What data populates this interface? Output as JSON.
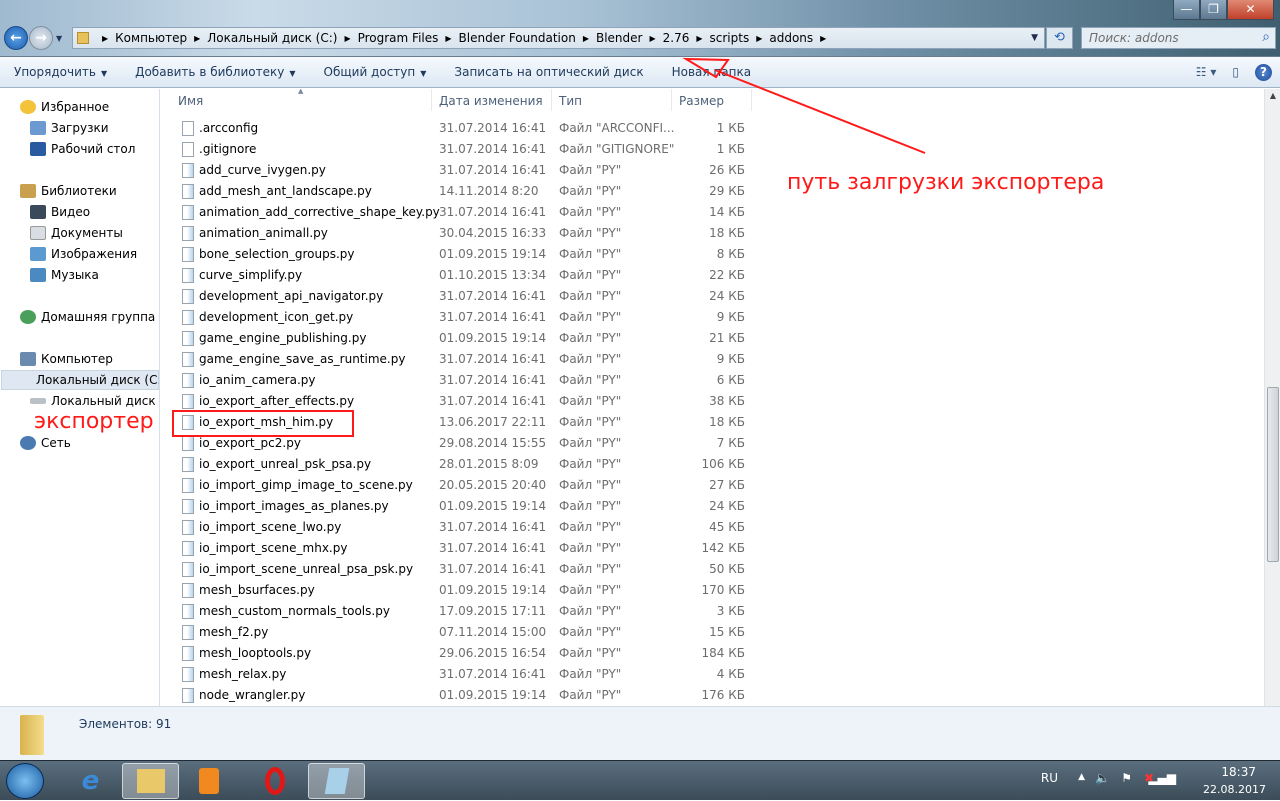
{
  "window": {
    "minimize": "minimize",
    "maximize": "restore",
    "close": "close"
  },
  "address": {
    "crumbs": [
      "Компьютер",
      "Локальный диск (C:)",
      "Program Files",
      "Blender Foundation",
      "Blender",
      "2.76",
      "scripts",
      "addons"
    ]
  },
  "search": {
    "placeholder": "Поиск: addons"
  },
  "toolbar": {
    "organize": "Упорядочить",
    "add_to_library": "Добавить в библиотеку",
    "share": "Общий доступ",
    "burn": "Записать на оптический диск",
    "new_folder": "Новая папка"
  },
  "sidebar": {
    "favorites": "Избранное",
    "downloads": "Загрузки",
    "desktop": "Рабочий стол",
    "libraries": "Библиотеки",
    "video": "Видео",
    "documents": "Документы",
    "images": "Изображения",
    "music": "Музыка",
    "homegroup": "Домашняя группа",
    "computer": "Компьютер",
    "disk_c": "Локальный диск (C:)",
    "disk_d": "Локальный диск (D:)",
    "network": "Сеть"
  },
  "columns": {
    "name": "Имя",
    "date": "Дата изменения",
    "type": "Тип",
    "size": "Размер"
  },
  "files": [
    {
      "name": ".arcconfig",
      "date": "31.07.2014 16:41",
      "type": "Файл \"ARCCONFI...",
      "size": "1 КБ",
      "plain": true
    },
    {
      "name": ".gitignore",
      "date": "31.07.2014 16:41",
      "type": "Файл \"GITIGNORE\"",
      "size": "1 КБ",
      "plain": true
    },
    {
      "name": "add_curve_ivygen.py",
      "date": "31.07.2014 16:41",
      "type": "Файл \"PY\"",
      "size": "26 КБ"
    },
    {
      "name": "add_mesh_ant_landscape.py",
      "date": "14.11.2014 8:20",
      "type": "Файл \"PY\"",
      "size": "29 КБ"
    },
    {
      "name": "animation_add_corrective_shape_key.py",
      "date": "31.07.2014 16:41",
      "type": "Файл \"PY\"",
      "size": "14 КБ"
    },
    {
      "name": "animation_animall.py",
      "date": "30.04.2015 16:33",
      "type": "Файл \"PY\"",
      "size": "18 КБ"
    },
    {
      "name": "bone_selection_groups.py",
      "date": "01.09.2015 19:14",
      "type": "Файл \"PY\"",
      "size": "8 КБ"
    },
    {
      "name": "curve_simplify.py",
      "date": "01.10.2015 13:34",
      "type": "Файл \"PY\"",
      "size": "22 КБ"
    },
    {
      "name": "development_api_navigator.py",
      "date": "31.07.2014 16:41",
      "type": "Файл \"PY\"",
      "size": "24 КБ"
    },
    {
      "name": "development_icon_get.py",
      "date": "31.07.2014 16:41",
      "type": "Файл \"PY\"",
      "size": "9 КБ"
    },
    {
      "name": "game_engine_publishing.py",
      "date": "01.09.2015 19:14",
      "type": "Файл \"PY\"",
      "size": "21 КБ"
    },
    {
      "name": "game_engine_save_as_runtime.py",
      "date": "31.07.2014 16:41",
      "type": "Файл \"PY\"",
      "size": "9 КБ"
    },
    {
      "name": "io_anim_camera.py",
      "date": "31.07.2014 16:41",
      "type": "Файл \"PY\"",
      "size": "6 КБ"
    },
    {
      "name": "io_export_after_effects.py",
      "date": "31.07.2014 16:41",
      "type": "Файл \"PY\"",
      "size": "38 КБ"
    },
    {
      "name": "io_export_msh_him.py",
      "date": "13.06.2017 22:11",
      "type": "Файл \"PY\"",
      "size": "18 КБ"
    },
    {
      "name": "io_export_pc2.py",
      "date": "29.08.2014 15:55",
      "type": "Файл \"PY\"",
      "size": "7 КБ"
    },
    {
      "name": "io_export_unreal_psk_psa.py",
      "date": "28.01.2015 8:09",
      "type": "Файл \"PY\"",
      "size": "106 КБ"
    },
    {
      "name": "io_import_gimp_image_to_scene.py",
      "date": "20.05.2015 20:40",
      "type": "Файл \"PY\"",
      "size": "27 КБ"
    },
    {
      "name": "io_import_images_as_planes.py",
      "date": "01.09.2015 19:14",
      "type": "Файл \"PY\"",
      "size": "24 КБ"
    },
    {
      "name": "io_import_scene_lwo.py",
      "date": "31.07.2014 16:41",
      "type": "Файл \"PY\"",
      "size": "45 КБ"
    },
    {
      "name": "io_import_scene_mhx.py",
      "date": "31.07.2014 16:41",
      "type": "Файл \"PY\"",
      "size": "142 КБ"
    },
    {
      "name": "io_import_scene_unreal_psa_psk.py",
      "date": "31.07.2014 16:41",
      "type": "Файл \"PY\"",
      "size": "50 КБ"
    },
    {
      "name": "mesh_bsurfaces.py",
      "date": "01.09.2015 19:14",
      "type": "Файл \"PY\"",
      "size": "170 КБ"
    },
    {
      "name": "mesh_custom_normals_tools.py",
      "date": "17.09.2015 17:11",
      "type": "Файл \"PY\"",
      "size": "3 КБ"
    },
    {
      "name": "mesh_f2.py",
      "date": "07.11.2014 15:00",
      "type": "Файл \"PY\"",
      "size": "15 КБ"
    },
    {
      "name": "mesh_looptools.py",
      "date": "29.06.2015 16:54",
      "type": "Файл \"PY\"",
      "size": "184 КБ"
    },
    {
      "name": "mesh_relax.py",
      "date": "31.07.2014 16:41",
      "type": "Файл \"PY\"",
      "size": "4 КБ"
    },
    {
      "name": "node_wrangler.py",
      "date": "01.09.2015 19:14",
      "type": "Файл \"PY\"",
      "size": "176 КБ"
    }
  ],
  "status": {
    "items": "Элементов: 91"
  },
  "tray": {
    "lang": "RU",
    "time": "18:37",
    "date": "22.08.2017"
  },
  "annotations": {
    "path_note": "путь залгрузки экспортера",
    "exporter_note": "экспортер",
    "color": "#ff1a1a"
  }
}
